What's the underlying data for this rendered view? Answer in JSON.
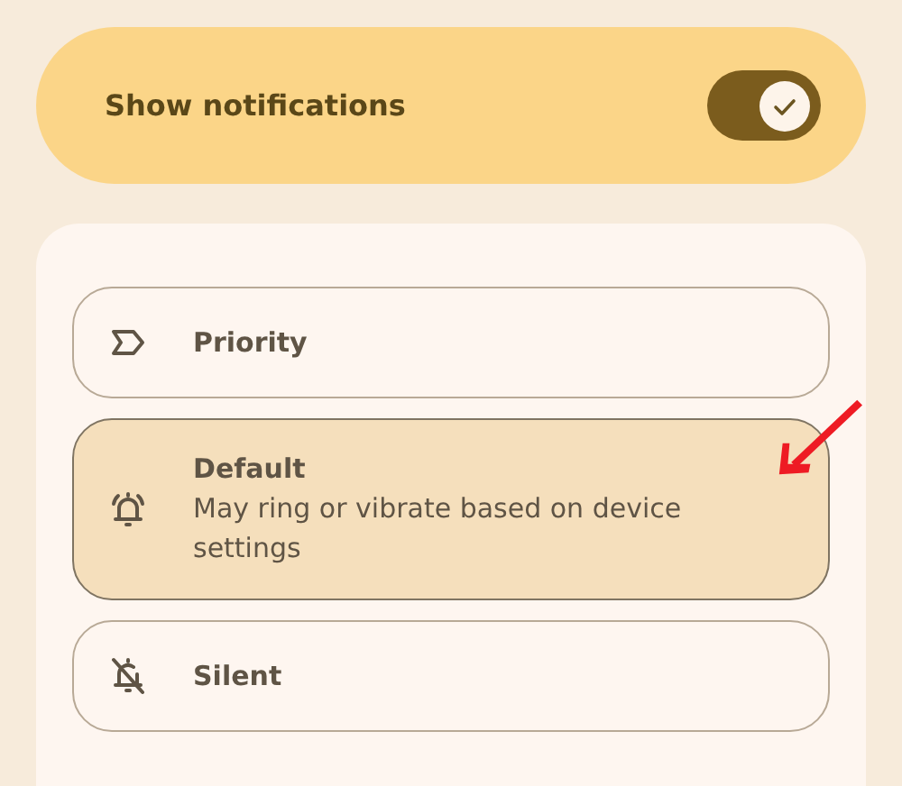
{
  "master": {
    "label": "Show notifications",
    "on": true
  },
  "options": [
    {
      "kind": "priority",
      "title": "Priority",
      "selected": false
    },
    {
      "kind": "default",
      "title": "Default",
      "description": "May ring or vibrate based on device settings",
      "selected": true
    },
    {
      "kind": "silent",
      "title": "Silent",
      "selected": false
    }
  ]
}
